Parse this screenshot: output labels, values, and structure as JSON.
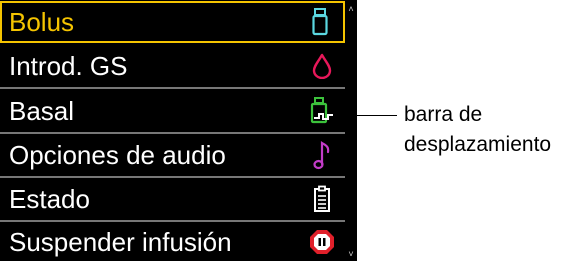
{
  "menu": {
    "items": [
      {
        "label": "Bolus",
        "icon": "bolus-vial-icon",
        "color": "#5bd7e0",
        "selected": true
      },
      {
        "label": "Introd. GS",
        "icon": "blood-drop-icon",
        "color": "#e8185a",
        "selected": false
      },
      {
        "label": "Basal",
        "icon": "basal-faucet-icon",
        "color": "#3cc23c",
        "selected": false
      },
      {
        "label": "Opciones de audio",
        "icon": "music-note-icon",
        "color": "#c33cc8",
        "selected": false
      },
      {
        "label": "Estado",
        "icon": "clipboard-icon",
        "color": "#ffffff",
        "selected": false
      },
      {
        "label": "Suspender infusión",
        "icon": "pause-octagon-icon",
        "color": "#e0202a",
        "selected": false
      }
    ]
  },
  "colors": {
    "screen_background": "#000000",
    "selection_highlight": "#f5c400",
    "divider": "#777777"
  },
  "callout": {
    "line1": "barra de",
    "line2": "desplazamiento"
  }
}
